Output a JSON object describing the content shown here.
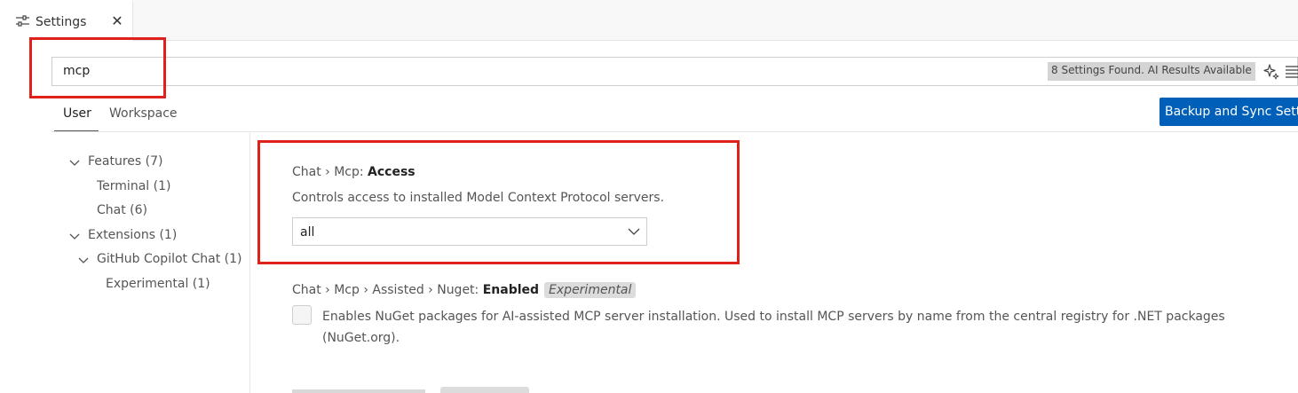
{
  "tab": {
    "label": "Settings",
    "close": "✕"
  },
  "search": {
    "value": "mcp",
    "results": "8 Settings Found. AI Results Available"
  },
  "scopes": {
    "user": "User",
    "workspace": "Workspace"
  },
  "sync_button": "Backup and Sync Sett",
  "toc": [
    {
      "label": "Features (7)",
      "expanded": true
    },
    {
      "label": "Terminal (1)"
    },
    {
      "label": "Chat (6)"
    },
    {
      "label": "Extensions (1)",
      "expanded": true
    },
    {
      "label": "GitHub Copilot Chat (1)",
      "expanded": true
    },
    {
      "label": "Experimental (1)"
    }
  ],
  "settings": [
    {
      "prefix": "Chat › Mcp: ",
      "name": "Access",
      "description": "Controls access to installed Model Context Protocol servers.",
      "value": "all"
    },
    {
      "prefix": "Chat › Mcp › Assisted › Nuget: ",
      "name": "Enabled",
      "badge": "Experimental",
      "description": "Enables NuGet packages for AI-assisted MCP server installation. Used to install MCP servers by name from the central registry for .NET packages (NuGet.org).",
      "checked": false
    }
  ],
  "colors": {
    "accent": "#005fb8",
    "annotation": "#e0201b"
  }
}
